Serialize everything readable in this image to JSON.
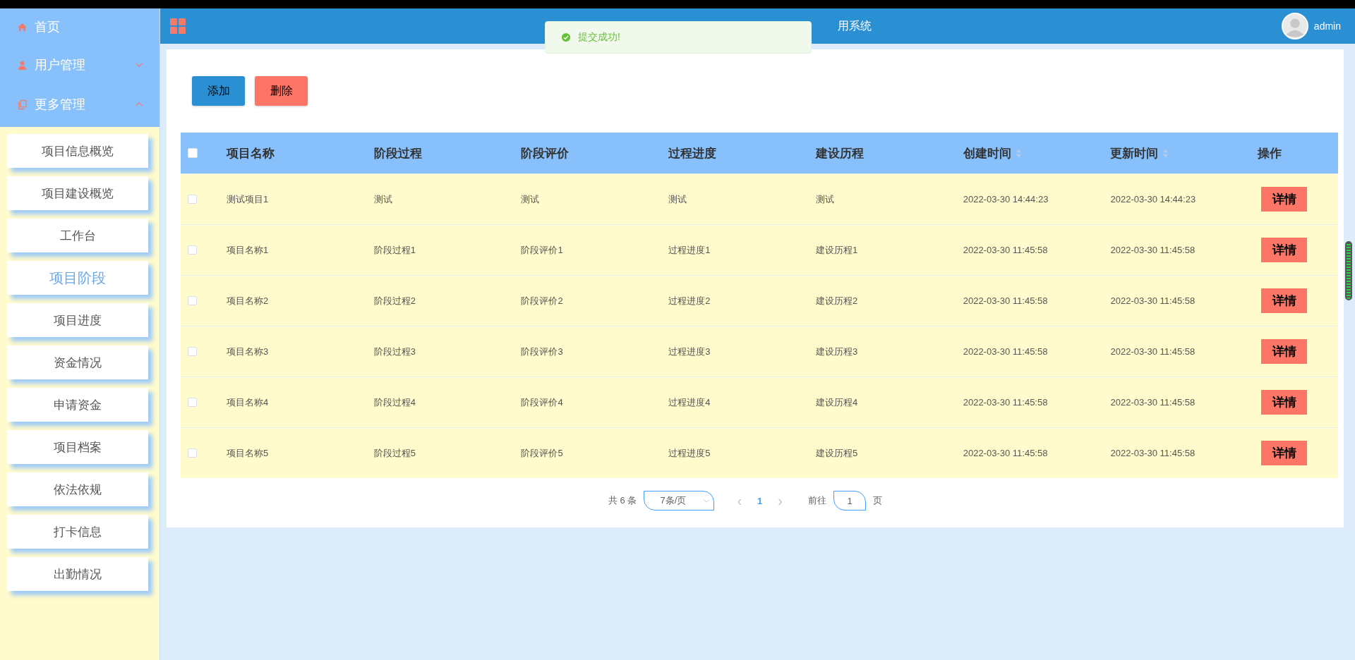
{
  "sidebar": {
    "menus": [
      {
        "label": "首页"
      },
      {
        "label": "用户管理",
        "expanded": false
      },
      {
        "label": "更多管理",
        "expanded": true
      }
    ],
    "items": [
      {
        "label": "项目信息概览",
        "selected": false
      },
      {
        "label": "项目建设概览",
        "selected": false
      },
      {
        "label": "工作台",
        "selected": false
      },
      {
        "label": "项目阶段",
        "selected": true
      },
      {
        "label": "项目进度",
        "selected": false
      },
      {
        "label": "资金情况",
        "selected": false
      },
      {
        "label": "申请资金",
        "selected": false
      },
      {
        "label": "项目档案",
        "selected": false
      },
      {
        "label": "依法依规",
        "selected": false
      },
      {
        "label": "打卡信息",
        "selected": false
      },
      {
        "label": "出勤情况",
        "selected": false
      }
    ]
  },
  "header": {
    "title": "用系统",
    "user": "admin"
  },
  "toast": {
    "message": "提交成功!"
  },
  "toolbar": {
    "buttons": [
      {
        "label": "添加",
        "kind": "add"
      },
      {
        "label": "删除",
        "kind": "delete"
      }
    ]
  },
  "table": {
    "select_all": false,
    "columns": [
      {
        "label": "项目名称",
        "sortable": false
      },
      {
        "label": "阶段过程",
        "sortable": false
      },
      {
        "label": "阶段评价",
        "sortable": false
      },
      {
        "label": "过程进度",
        "sortable": false
      },
      {
        "label": "建设历程",
        "sortable": false
      },
      {
        "label": "创建时间",
        "sortable": true
      },
      {
        "label": "更新时间",
        "sortable": true
      },
      {
        "label": "操作",
        "sortable": false
      }
    ],
    "rows": [
      {
        "checked": false,
        "cells": [
          "测试项目1",
          "测试",
          "测试",
          "测试",
          "测试",
          "2022-03-30 14:44:23",
          "2022-03-30 14:44:23"
        ],
        "action": "详情"
      },
      {
        "checked": false,
        "cells": [
          "项目名称1",
          "阶段过程1",
          "阶段评价1",
          "过程进度1",
          "建设历程1",
          "2022-03-30 11:45:58",
          "2022-03-30 11:45:58"
        ],
        "action": "详情"
      },
      {
        "checked": false,
        "cells": [
          "项目名称2",
          "阶段过程2",
          "阶段评价2",
          "过程进度2",
          "建设历程2",
          "2022-03-30 11:45:58",
          "2022-03-30 11:45:58"
        ],
        "action": "详情"
      },
      {
        "checked": false,
        "cells": [
          "项目名称3",
          "阶段过程3",
          "阶段评价3",
          "过程进度3",
          "建设历程3",
          "2022-03-30 11:45:58",
          "2022-03-30 11:45:58"
        ],
        "action": "详情"
      },
      {
        "checked": false,
        "cells": [
          "项目名称4",
          "阶段过程4",
          "阶段评价4",
          "过程进度4",
          "建设历程4",
          "2022-03-30 11:45:58",
          "2022-03-30 11:45:58"
        ],
        "action": "详情"
      },
      {
        "checked": false,
        "cells": [
          "项目名称5",
          "阶段过程5",
          "阶段评价5",
          "过程进度5",
          "建设历程5",
          "2022-03-30 11:45:58",
          "2022-03-30 11:45:58"
        ],
        "action": "详情"
      }
    ]
  },
  "pagination": {
    "total": "共 6 条",
    "page_size": "7条/页",
    "prev": "‹",
    "pages": [
      {
        "label": "1",
        "selected": true
      }
    ],
    "next": "›",
    "goto_label": "前往",
    "goto_value": "1",
    "goto_suffix": "页"
  }
}
